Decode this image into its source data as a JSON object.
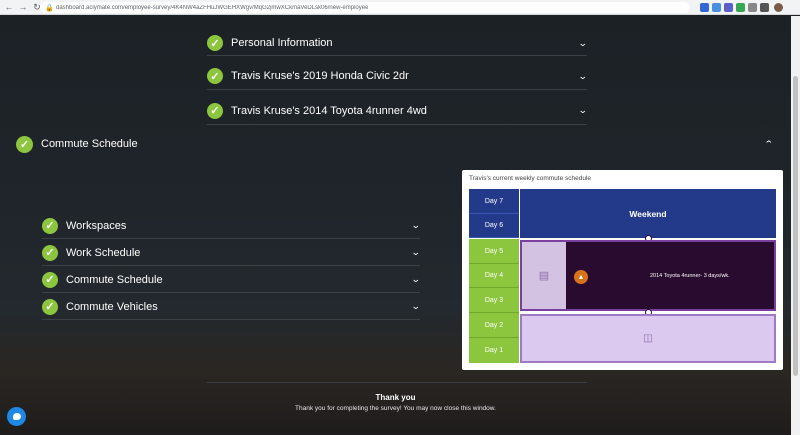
{
  "browser": {
    "url": "dashboard.aclymate.com/employee-survey/4K4NW4aZFHuJWGEHXWgv/MqG2jmwXCkmaVeDLsk06/new-employee",
    "back_icon": "arrow-left-icon",
    "forward_icon": "arrow-right-icon",
    "reload_icon": "reload-icon",
    "lock_icon": "lock-icon"
  },
  "vehicle_sections": [
    {
      "label": "Personal Information"
    },
    {
      "label": "Travis Kruse's 2019 Honda Civic 2dr"
    },
    {
      "label": "Travis Kruse's 2014 Toyota 4runner 4wd"
    }
  ],
  "commute_header": {
    "label": "Commute Schedule"
  },
  "sub_sections": [
    {
      "label": "Workspaces"
    },
    {
      "label": "Work Schedule"
    },
    {
      "label": "Commute Schedule"
    },
    {
      "label": "Commute Vehicles"
    }
  ],
  "schedule_card": {
    "title": "Travis's current weekly commute schedule",
    "days": [
      "Day 7",
      "Day 6",
      "Day 5",
      "Day 4",
      "Day 3",
      "Day 2",
      "Day 1"
    ],
    "weekend_label": "Weekend",
    "vehicle_block_text": "2014 Toyota 4runner- 3 days/wk."
  },
  "thanks": {
    "title": "Thank you",
    "message": "Thank you for completing the survey! You may now close this window."
  },
  "colors": {
    "accent_green": "#8cc63f",
    "navy": "#233a8b",
    "purple_dark": "#2a0b30",
    "purple_light": "#dcc9ef"
  }
}
